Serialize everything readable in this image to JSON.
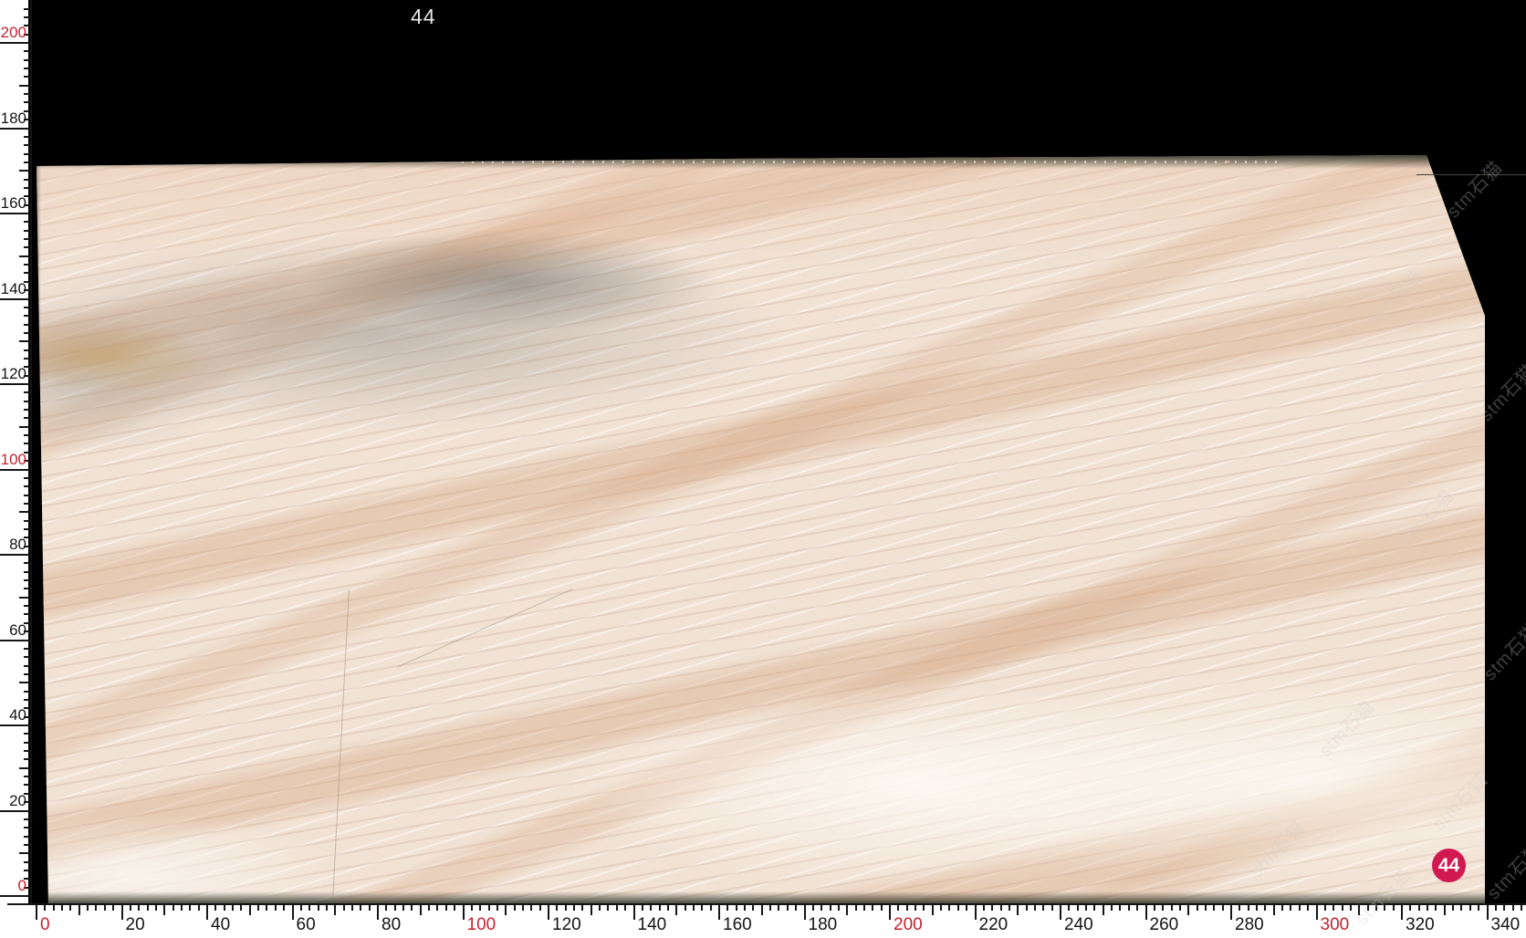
{
  "title": {
    "slab_number": "44"
  },
  "badge": {
    "number": "44"
  },
  "watermark": {
    "text": "stm石猫",
    "icon": "paw-icon"
  },
  "colors": {
    "background": "#000000",
    "ruler_red": "#c5232f",
    "ruler_black": "#141414",
    "badge_bg": "#d11950",
    "badge_text": "#ffffff",
    "title_text": "#e8e8e6",
    "slab_base": "#f1e2d4",
    "slab_vein_tan": "#cf9f77",
    "slab_smudge_grey": "#8c8985",
    "slab_gold_spot": "#c49a4e"
  },
  "rulers": {
    "vertical": {
      "side": "left",
      "labels": [
        "200",
        "180",
        "160",
        "140",
        "120",
        "100",
        "80",
        "60",
        "40",
        "20",
        "0"
      ],
      "red_labels": [
        "200",
        "100",
        "0"
      ]
    },
    "horizontal": {
      "side": "bottom",
      "labels": [
        "0",
        "20",
        "40",
        "60",
        "80",
        "100",
        "120",
        "140",
        "160",
        "180",
        "200",
        "220",
        "240",
        "260",
        "280",
        "300",
        "320",
        "340"
      ],
      "red_labels": [
        "0",
        "100",
        "200",
        "300"
      ]
    }
  }
}
